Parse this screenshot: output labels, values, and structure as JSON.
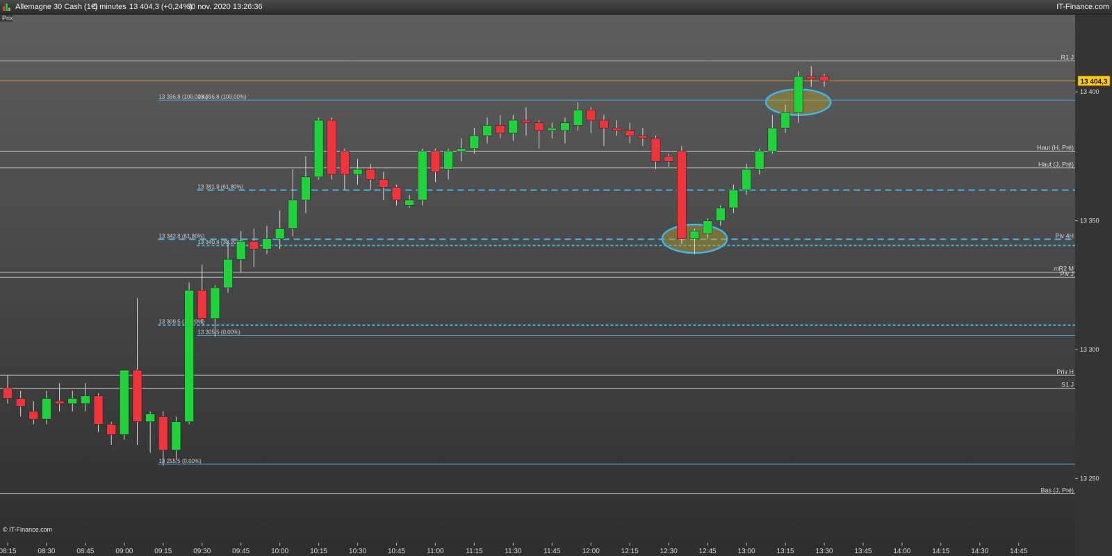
{
  "header": {
    "instrument": "Allemagne 30 Cash (1€)",
    "timeframe": "5 minutes",
    "quote": "13 404,3 (+0,24%)",
    "datetime": "30 nov. 2020 13:26:36",
    "brand": "IT-Finance.com"
  },
  "panel_label": "Prix",
  "watermark": "© IT-Finance.com",
  "chart_data": {
    "type": "candlestick",
    "ylim": [
      13225,
      13430
    ],
    "y_ticks": [
      {
        "value": 13400,
        "label": "13 400"
      },
      {
        "value": 13350,
        "label": "13 350"
      },
      {
        "value": 13300,
        "label": "13 300"
      },
      {
        "value": 13250,
        "label": "13 250"
      }
    ],
    "x_ticks": [
      "08:15",
      "08:30",
      "08:45",
      "09:00",
      "09:15",
      "09:30",
      "09:45",
      "10:00",
      "10:15",
      "10:30",
      "10:45",
      "11:00",
      "11:15",
      "11:30",
      "11:45",
      "12:00",
      "12:15",
      "12:30",
      "12:45",
      "13:00",
      "13:15",
      "13:30",
      "13:45",
      "14:00",
      "14:15",
      "14:30",
      "14:45"
    ],
    "last_price": {
      "value": 13404.3,
      "label": "13 404,3",
      "color": "#ffcc00"
    },
    "candles": [
      {
        "t": "08:15",
        "o": 13285,
        "h": 13290,
        "l": 13279,
        "c": 13281
      },
      {
        "t": "08:20",
        "o": 13281,
        "h": 13284,
        "l": 13274,
        "c": 13278
      },
      {
        "t": "08:25",
        "o": 13276,
        "h": 13280,
        "l": 13271,
        "c": 13273
      },
      {
        "t": "08:30",
        "o": 13273,
        "h": 13284,
        "l": 13271,
        "c": 13281
      },
      {
        "t": "08:35",
        "o": 13280,
        "h": 13287,
        "l": 13276,
        "c": 13279
      },
      {
        "t": "08:40",
        "o": 13279,
        "h": 13284,
        "l": 13276,
        "c": 13281
      },
      {
        "t": "08:45",
        "o": 13279,
        "h": 13287,
        "l": 13276,
        "c": 13282
      },
      {
        "t": "08:50",
        "o": 13282,
        "h": 13283,
        "l": 13268,
        "c": 13271
      },
      {
        "t": "08:55",
        "o": 13271,
        "h": 13272,
        "l": 13263,
        "c": 13267
      },
      {
        "t": "09:00",
        "o": 13267,
        "h": 13292,
        "l": 13265,
        "c": 13292
      },
      {
        "t": "09:05",
        "o": 13292,
        "h": 13320,
        "l": 13263,
        "c": 13272
      },
      {
        "t": "09:10",
        "o": 13272,
        "h": 13276,
        "l": 13260,
        "c": 13275
      },
      {
        "t": "09:15",
        "o": 13274,
        "h": 13276,
        "l": 13255,
        "c": 13261
      },
      {
        "t": "09:20",
        "o": 13261,
        "h": 13274,
        "l": 13257,
        "c": 13272
      },
      {
        "t": "09:25",
        "o": 13272,
        "h": 13326,
        "l": 13271,
        "c": 13323
      },
      {
        "t": "09:30",
        "o": 13323,
        "h": 13333,
        "l": 13310,
        "c": 13312
      },
      {
        "t": "09:35",
        "o": 13312,
        "h": 13325,
        "l": 13305,
        "c": 13324
      },
      {
        "t": "09:40",
        "o": 13324,
        "h": 13342,
        "l": 13322,
        "c": 13335
      },
      {
        "t": "09:45",
        "o": 13335,
        "h": 13346,
        "l": 13330,
        "c": 13342
      },
      {
        "t": "09:50",
        "o": 13342,
        "h": 13347,
        "l": 13332,
        "c": 13339
      },
      {
        "t": "09:55",
        "o": 13339,
        "h": 13348,
        "l": 13337,
        "c": 13343
      },
      {
        "t": "10:00",
        "o": 13343,
        "h": 13354,
        "l": 13339,
        "c": 13347
      },
      {
        "t": "10:05",
        "o": 13347,
        "h": 13370,
        "l": 13344,
        "c": 13358
      },
      {
        "t": "10:10",
        "o": 13358,
        "h": 13375,
        "l": 13353,
        "c": 13367
      },
      {
        "t": "10:15",
        "o": 13367,
        "h": 13390,
        "l": 13366,
        "c": 13389
      },
      {
        "t": "10:20",
        "o": 13389,
        "h": 13390,
        "l": 13366,
        "c": 13368
      },
      {
        "t": "10:25",
        "o": 13377,
        "h": 13378,
        "l": 13362,
        "c": 13368
      },
      {
        "t": "10:30",
        "o": 13368,
        "h": 13374,
        "l": 13364,
        "c": 13370
      },
      {
        "t": "10:35",
        "o": 13370,
        "h": 13372,
        "l": 13362,
        "c": 13366
      },
      {
        "t": "10:40",
        "o": 13366,
        "h": 13369,
        "l": 13358,
        "c": 13363
      },
      {
        "t": "10:45",
        "o": 13363,
        "h": 13364,
        "l": 13356,
        "c": 13358
      },
      {
        "t": "10:50",
        "o": 13356,
        "h": 13360,
        "l": 13355,
        "c": 13358
      },
      {
        "t": "10:55",
        "o": 13358,
        "h": 13378,
        "l": 13356,
        "c": 13377
      },
      {
        "t": "11:00",
        "o": 13377,
        "h": 13378,
        "l": 13365,
        "c": 13369
      },
      {
        "t": "11:05",
        "o": 13370,
        "h": 13378,
        "l": 13366,
        "c": 13377
      },
      {
        "t": "11:10",
        "o": 13377,
        "h": 13382,
        "l": 13373,
        "c": 13378
      },
      {
        "t": "11:15",
        "o": 13378,
        "h": 13386,
        "l": 13376,
        "c": 13383
      },
      {
        "t": "11:20",
        "o": 13383,
        "h": 13390,
        "l": 13380,
        "c": 13387
      },
      {
        "t": "11:25",
        "o": 13387,
        "h": 13391,
        "l": 13382,
        "c": 13384
      },
      {
        "t": "11:30",
        "o": 13384,
        "h": 13391,
        "l": 13381,
        "c": 13389
      },
      {
        "t": "11:35",
        "o": 13389,
        "h": 13394,
        "l": 13383,
        "c": 13388
      },
      {
        "t": "11:40",
        "o": 13388,
        "h": 13389,
        "l": 13378,
        "c": 13385
      },
      {
        "t": "11:45",
        "o": 13385,
        "h": 13388,
        "l": 13382,
        "c": 13386
      },
      {
        "t": "11:50",
        "o": 13385,
        "h": 13390,
        "l": 13380,
        "c": 13388
      },
      {
        "t": "11:55",
        "o": 13387,
        "h": 13396,
        "l": 13385,
        "c": 13393
      },
      {
        "t": "12:00",
        "o": 13393,
        "h": 13394,
        "l": 13384,
        "c": 13389
      },
      {
        "t": "12:05",
        "o": 13389,
        "h": 13391,
        "l": 13379,
        "c": 13386
      },
      {
        "t": "12:10",
        "o": 13386,
        "h": 13389,
        "l": 13383,
        "c": 13385
      },
      {
        "t": "12:15",
        "o": 13385,
        "h": 13388,
        "l": 13380,
        "c": 13383
      },
      {
        "t": "12:20",
        "o": 13383,
        "h": 13386,
        "l": 13379,
        "c": 13382
      },
      {
        "t": "12:25",
        "o": 13382,
        "h": 13383,
        "l": 13370,
        "c": 13373
      },
      {
        "t": "12:30",
        "o": 13375,
        "h": 13376,
        "l": 13371,
        "c": 13373
      },
      {
        "t": "12:35",
        "o": 13377,
        "h": 13379,
        "l": 13341,
        "c": 13343
      },
      {
        "t": "12:40",
        "o": 13343,
        "h": 13347,
        "l": 13337,
        "c": 13346
      },
      {
        "t": "12:45",
        "o": 13345,
        "h": 13351,
        "l": 13343,
        "c": 13350
      },
      {
        "t": "12:50",
        "o": 13350,
        "h": 13356,
        "l": 13348,
        "c": 13355
      },
      {
        "t": "12:55",
        "o": 13355,
        "h": 13364,
        "l": 13353,
        "c": 13362
      },
      {
        "t": "13:00",
        "o": 13362,
        "h": 13372,
        "l": 13360,
        "c": 13370
      },
      {
        "t": "13:05",
        "o": 13370,
        "h": 13378,
        "l": 13368,
        "c": 13377
      },
      {
        "t": "13:10",
        "o": 13377,
        "h": 13391,
        "l": 13376,
        "c": 13386
      },
      {
        "t": "13:15",
        "o": 13386,
        "h": 13395,
        "l": 13384,
        "c": 13392
      },
      {
        "t": "13:20",
        "o": 13392,
        "h": 13408,
        "l": 13388,
        "c": 13406
      },
      {
        "t": "13:25",
        "o": 13406,
        "h": 13410,
        "l": 13402,
        "c": 13405
      },
      {
        "t": "13:30",
        "o": 13406,
        "h": 13407,
        "l": 13402,
        "c": 13404.3
      }
    ],
    "levels": [
      {
        "label": "R1 J",
        "value": 13412,
        "color": "#b4b4b4",
        "style": "solid"
      },
      {
        "label": "",
        "value": 13404.3,
        "color": "#e09a20",
        "style": "solid"
      },
      {
        "label": "",
        "value": 13396.8,
        "color": "#3aaee8",
        "style": "solid",
        "start": "09:15"
      },
      {
        "label": "Haut (H, Pré)",
        "value": 13377,
        "color": "#cfcfcf",
        "style": "solid"
      },
      {
        "label": "Haut (J, Pré)",
        "value": 13370.5,
        "color": "#cfcfcf",
        "style": "solid"
      },
      {
        "label": "",
        "value": 13361.9,
        "color": "#3ab8ee",
        "style": "dashed",
        "start": "09:30"
      },
      {
        "label": "Piv 4H",
        "value": 13342.8,
        "color": "#3ab8ee",
        "style": "dashed",
        "start": "09:15"
      },
      {
        "label": "",
        "value": 13340.4,
        "color": "#3ab8ee",
        "style": "dotted",
        "start": "09:30"
      },
      {
        "label": "mR2 M",
        "value": 13330,
        "color": "#cfcfcf",
        "style": "solid"
      },
      {
        "label": "Piv J",
        "value": 13328,
        "color": "#cfcfcf",
        "style": "solid"
      },
      {
        "label": "",
        "value": 13309.5,
        "color": "#3ab8ee",
        "style": "dotted",
        "start": "09:15"
      },
      {
        "label": "",
        "value": 13305.5,
        "color": "#3aaee8",
        "style": "solid",
        "start": "09:30"
      },
      {
        "label": "Priv H",
        "value": 13290,
        "color": "#cfcfcf",
        "style": "solid"
      },
      {
        "label": "S1 J",
        "value": 13285,
        "color": "#cfcfcf",
        "style": "solid"
      },
      {
        "label": "",
        "value": 13255.5,
        "color": "#3aaee8",
        "style": "solid",
        "start": "09:15"
      },
      {
        "label": "Bas (J, Pré)",
        "value": 13244,
        "color": "#cfcfcf",
        "style": "solid"
      }
    ],
    "fib_labels": [
      {
        "text": "13 396,8 (100,00%)",
        "t": "09:15",
        "value": 13396.8
      },
      {
        "text": "13 396,8 (100,00%)",
        "t": "09:30",
        "value": 13396.8
      },
      {
        "text": "13 361,9 (61,80%)",
        "t": "09:30",
        "value": 13361.9
      },
      {
        "text": "13 342,8 (61,80%)",
        "t": "09:15",
        "value": 13342.8
      },
      {
        "text": "13 340,4 (38,20%)",
        "t": "09:30",
        "value": 13340.4
      },
      {
        "text": "13 309,5 (38,20%)",
        "t": "09:15",
        "value": 13309.5
      },
      {
        "text": "13 305,5 (0,00%)",
        "t": "09:30",
        "value": 13305.5
      },
      {
        "text": "13 255,5 (0,00%)",
        "t": "09:15",
        "value": 13255.5
      }
    ],
    "highlights": [
      {
        "t": "12:40",
        "value": 13343,
        "rx_bars": 2.5,
        "ry_value": 5.5
      },
      {
        "t": "13:20",
        "value": 13396,
        "rx_bars": 2.5,
        "ry_value": 5.0
      }
    ],
    "colors": {
      "up": "#1fd33a",
      "down": "#f0343c",
      "wick": "#d8d8d8"
    }
  }
}
